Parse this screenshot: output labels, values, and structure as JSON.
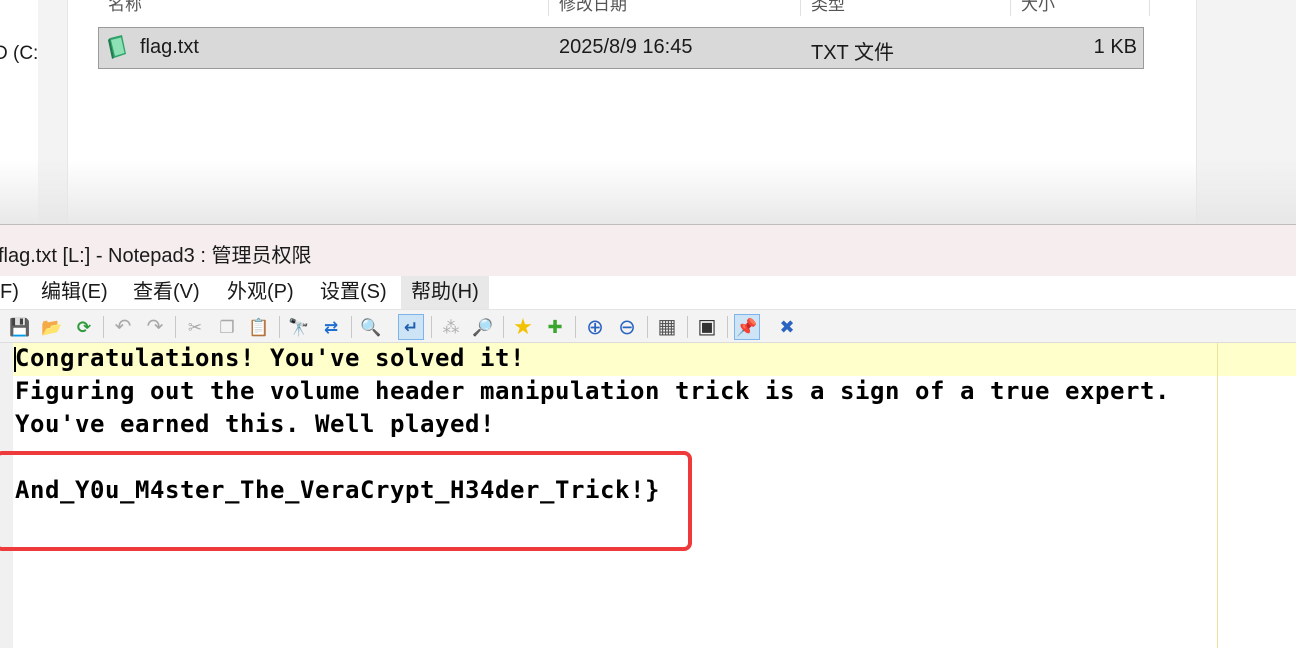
{
  "explorer": {
    "nav_partial_label": "D (C:",
    "columns": [
      "名称",
      "修改日期",
      "类型",
      "大小"
    ],
    "file": {
      "name": "flag.txt",
      "modified": "2025/8/9 16:45",
      "type": "TXT 文件",
      "size": "1 KB",
      "icon": "text-file-icon"
    }
  },
  "notepad": {
    "title": "flag.txt [L:] - Notepad3 : 管理员权限",
    "menu": [
      "F)",
      "编辑(E)",
      "查看(V)",
      "外观(P)",
      "设置(S)",
      "帮助(H)"
    ],
    "toolbar": {
      "save": "💾",
      "open": "📂",
      "reload": "⟳",
      "undo": "↶",
      "redo": "↷",
      "cut": "✂",
      "copy": "❐",
      "paste": "📋",
      "find": "🔭",
      "replace": "⇄",
      "goto": "🔍",
      "wordwrap": "↵",
      "tree": "⁂",
      "zoom_search": "🔎",
      "favorites": "★",
      "add_favorite": "✚",
      "zoom_in": "⊕",
      "zoom_out": "⊖",
      "scheme": "▦",
      "terminal": "▣",
      "pin": "📌",
      "close": "✖"
    },
    "content": {
      "line1": "Congratulations! You've solved it!",
      "line2": "Figuring out the volume header manipulation trick is a sign of a true expert.",
      "line3": "You've earned this. Well played!",
      "line4": "",
      "line5": "And_Y0u_M4ster_The_VeraCrypt_H34der_Trick!}"
    },
    "colors": {
      "current_line": "#ffffcc",
      "highlight_box": "#ee3a3a",
      "titlebar": "#f6eeee"
    }
  }
}
